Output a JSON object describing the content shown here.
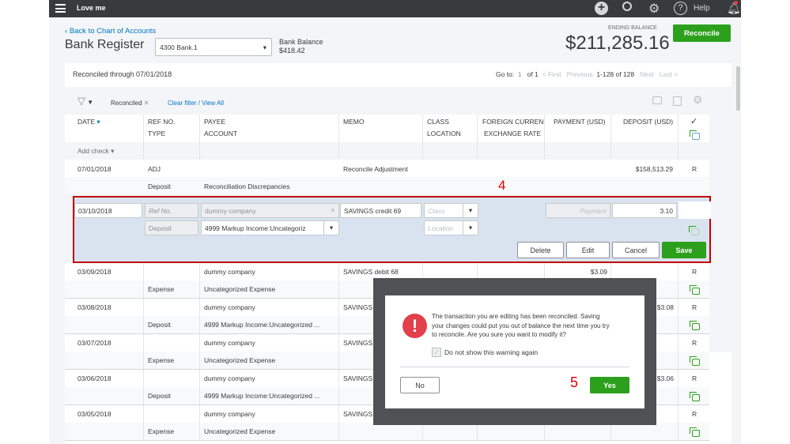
{
  "topbar": {
    "company": "Love me",
    "help": "Help"
  },
  "header": {
    "back_link": "Back to Chart of Accounts",
    "title": "Bank Register",
    "account": "4300 Bank.1",
    "bank_balance_label": "Bank Balance",
    "bank_balance": "$418.42",
    "ending_balance_label": "ENDING BALANCE",
    "ending_balance": "$211,285.16",
    "reconcile": "Reconcile"
  },
  "panel": {
    "reconciled_through": "Reconciled through 07/01/2018",
    "goto_label": "Go to:",
    "page": "1",
    "of_pages": "of 1",
    "first": "< First",
    "previous": "Previous",
    "range": "1-128 of 128",
    "next": "Next",
    "last": "Last >"
  },
  "filter": {
    "chip": "Reconciled",
    "clear": "Clear filter / View All"
  },
  "columns": {
    "date": "DATE",
    "ref": "REF NO.",
    "type": "TYPE",
    "payee": "PAYEE",
    "account": "ACCOUNT",
    "memo": "MEMO",
    "class": "CLASS",
    "location": "LOCATION",
    "foreign": "FOREIGN CURRENCY",
    "exchange": "EXCHANGE RATE",
    "payment": "PAYMENT (USD)",
    "deposit": "DEPOSIT (USD)",
    "check": "✓"
  },
  "add_check": "Add check",
  "first_row": {
    "date": "07/01/2018",
    "ref": "ADJ",
    "type": "Deposit",
    "account": "Reconciliation Discrepancies",
    "memo": "Reconcile Adjustment",
    "deposit": "$158,513.29",
    "status": "R"
  },
  "edit_row": {
    "date": "03/10/2018",
    "ref_placeholder": "Ref No.",
    "payee": "dummy company",
    "memo": "SAVINGS credit 69",
    "class_placeholder": "Class",
    "type": "Deposit",
    "account": "4999 Markup Income:Uncategoriz",
    "location_placeholder": "Location",
    "payment_placeholder": "Payment",
    "deposit": "3.10",
    "delete": "Delete",
    "edit": "Edit",
    "cancel": "Cancel",
    "save": "Save"
  },
  "rows": [
    {
      "date": "03/09/2018",
      "payee": "dummy company",
      "type": "Expense",
      "account": "Uncategorized Expense",
      "memo": "SAVINGS debit 68",
      "payment": "$3.09",
      "deposit": "",
      "status": "R"
    },
    {
      "date": "03/08/2018",
      "payee": "dummy company",
      "type": "Deposit",
      "account": "4999 Markup Income:Uncategorized ...",
      "memo": "SAVINGS",
      "payment": "",
      "deposit": "$3.08",
      "status": "R"
    },
    {
      "date": "03/07/2018",
      "payee": "dummy company",
      "type": "Expense",
      "account": "Uncategorized Expense",
      "memo": "SAVINGS",
      "payment": "",
      "deposit": "",
      "status": "R"
    },
    {
      "date": "03/06/2018",
      "payee": "dummy company",
      "type": "Deposit",
      "account": "4999 Markup Income:Uncategorized ...",
      "memo": "SAVINGS",
      "payment": "",
      "deposit": "$3.06",
      "status": "R"
    },
    {
      "date": "03/05/2018",
      "payee": "dummy company",
      "type": "Expense",
      "account": "Uncategorized Expense",
      "memo": "SAVINGS",
      "payment": "",
      "deposit": "",
      "status": "R"
    }
  ],
  "annotations": {
    "step4": "4",
    "step5": "5"
  },
  "dialog": {
    "message": "The transaction you are editing has been reconciled. Saving your changes could put you out of balance the next time you try to reconcile. Are you sure you want to modify it?",
    "checkbox": "Do not show this warning again",
    "no": "No",
    "yes": "Yes"
  },
  "colors": {
    "accent": "#2ca01c",
    "link": "#0077c5",
    "warning": "#e2404b",
    "highlight": "#c00000"
  }
}
